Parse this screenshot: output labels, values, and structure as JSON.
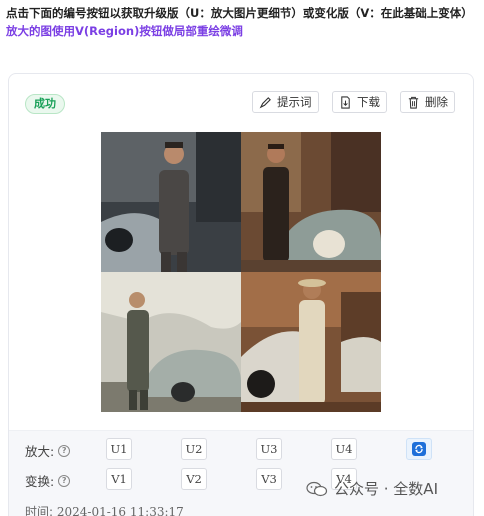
{
  "intro": {
    "text": "点击下面的编号按钮以获取升级版（U：放大图片更细节）或变化版（V：在此基础上变体）",
    "link": "放大的图使用V(Region)按钮做局部重绘微调"
  },
  "card": {
    "status_badge": "成功",
    "toolbar": {
      "prompt_label": "提示词",
      "download_label": "下载",
      "delete_label": "删除"
    },
    "upscale": {
      "label": "放大:",
      "buttons": [
        "U1",
        "U2",
        "U3",
        "U4"
      ]
    },
    "variation": {
      "label": "变换:",
      "buttons": [
        "V1",
        "V2",
        "V3",
        "V4"
      ]
    },
    "time": {
      "label": "时间:",
      "value": "2024-01-16 11:33:17"
    }
  },
  "watermark": {
    "text": "公众号 · 全数AI"
  },
  "colors": {
    "accent": "#7b3fe4",
    "success": "#18a058",
    "refresh": "#1e6fd9"
  }
}
